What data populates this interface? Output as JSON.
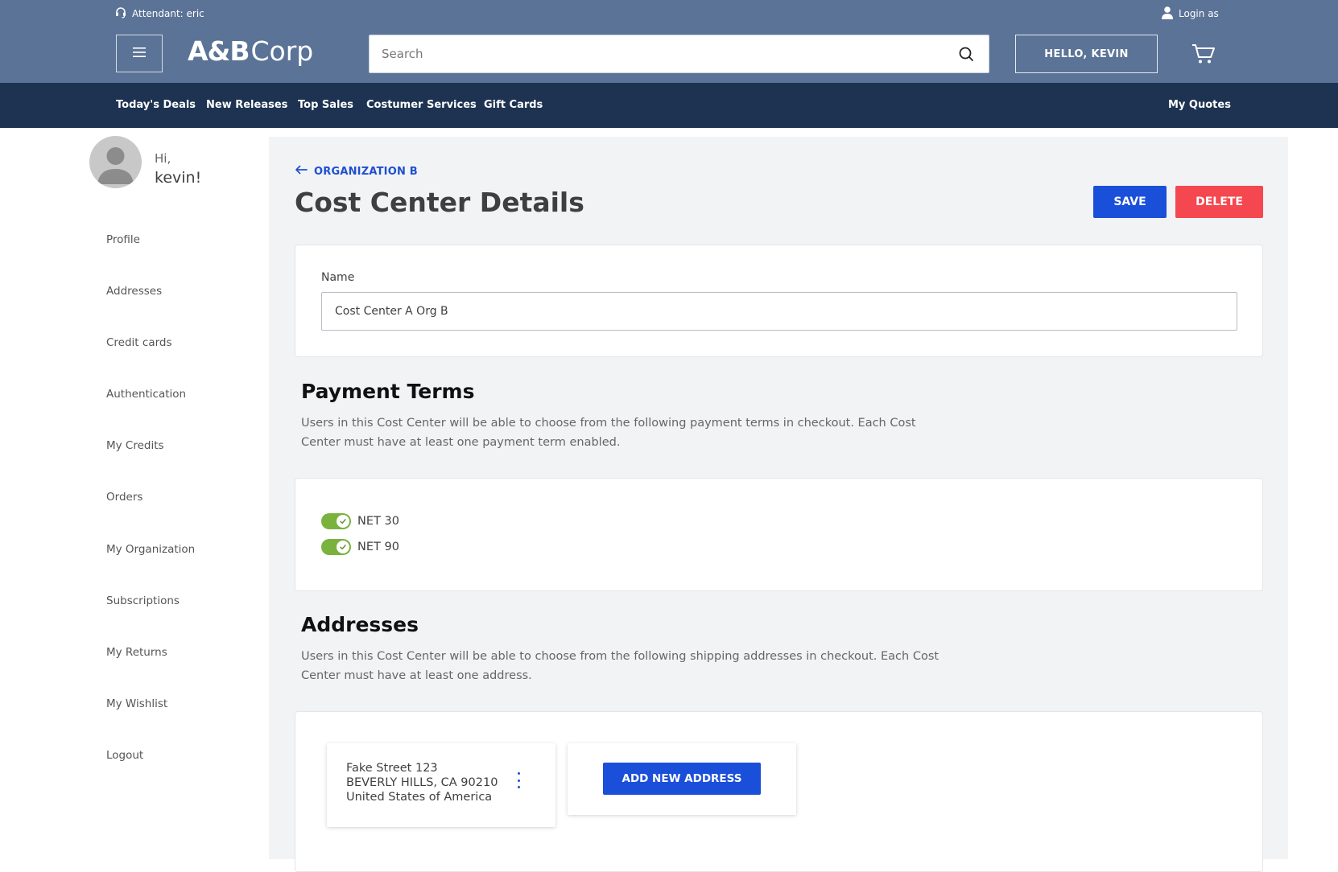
{
  "header": {
    "attendant": "Attendant: eric",
    "login_as": "Login as",
    "logo_ab": "A&B",
    "logo_corp": "Corp",
    "search_placeholder": "Search",
    "hello_button": "HELLO, KEVIN"
  },
  "nav": {
    "items": [
      "Today's Deals",
      "New Releases",
      "Top Sales",
      "Costumer Services",
      "Gift Cards"
    ],
    "my_quotes": "My Quotes"
  },
  "sidebar": {
    "greeting_hi": "Hi,",
    "greeting_name": "kevin!",
    "items": [
      "Profile",
      "Addresses",
      "Credit cards",
      "Authentication",
      "My Credits",
      "Orders",
      "My Organization",
      "Subscriptions",
      "My Returns",
      "My Wishlist",
      "Logout"
    ]
  },
  "main": {
    "breadcrumb": "ORGANIZATION B",
    "title": "Cost Center Details",
    "save_label": "SAVE",
    "delete_label": "DELETE",
    "name_label": "Name",
    "name_value": "Cost Center A Org B",
    "payment_terms": {
      "title": "Payment Terms",
      "description_line1": "Users in this Cost Center will be able to choose from the following payment terms in checkout. Each Cost",
      "description_line2": "Center must have at least one payment term enabled.",
      "terms": [
        {
          "label": "NET 30",
          "enabled": true
        },
        {
          "label": "NET 90",
          "enabled": true
        }
      ]
    },
    "addresses": {
      "title": "Addresses",
      "description_line1": "Users in this Cost Center will be able to choose from the following shipping addresses in checkout. Each Cost",
      "description_line2": "Center must have at least one address.",
      "items": [
        {
          "street": "Fake Street 123",
          "city": "BEVERLY HILLS, CA 90210",
          "country": "United States of America"
        }
      ],
      "add_label": "ADD NEW ADDRESS"
    }
  },
  "colors": {
    "header_bg": "#5b7396",
    "nav_bg": "#1d3351",
    "primary": "#1a4fd9",
    "danger": "#f4474f",
    "toggle_on": "#79b23c"
  },
  "icons": [
    "headset-icon",
    "user-icon",
    "menu-icon",
    "search-icon",
    "cart-icon",
    "arrow-left-icon",
    "check-icon",
    "kebab-icon"
  ]
}
